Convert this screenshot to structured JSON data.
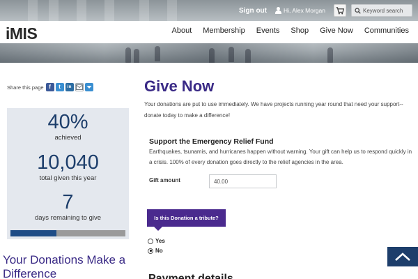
{
  "header": {
    "sign_out": "Sign out",
    "user_greeting": "Hi, Alex Morgan",
    "search_placeholder": "Keyword search",
    "logo": "iMIS",
    "nav": [
      "About",
      "Membership",
      "Events",
      "Shop",
      "Give Now",
      "Communities"
    ]
  },
  "share": {
    "label": "Share this page",
    "icons": [
      "facebook-icon",
      "twitter-icon",
      "linkedin-icon",
      "email-icon",
      "more-icon"
    ]
  },
  "stats": {
    "percent": "40%",
    "percent_label": "achieved",
    "total": "10,040",
    "total_label": "total given this year",
    "days": "7",
    "days_label": "days remaining to give",
    "progress_fraction": 0.4
  },
  "left_heading": "Your Donations Make a Difference",
  "main": {
    "title": "Give Now",
    "intro": "Your donations are put to use immediately. We have projects running year round that need your support--donate today to make a difference!",
    "fund_title": "Support the Emergency Relief Fund",
    "fund_desc": "Earthquakes, tsunamis, and hurricanes happen without warning. Your gift can help us to respond quickly in a crisis. 100% of every donation goes directly to the relief agencies in the area.",
    "gift_label": "Gift amount",
    "gift_value": "40.00",
    "tribute_question": "Is this Donation a tribute?",
    "options": [
      {
        "label": "Yes",
        "selected": false
      },
      {
        "label": "No",
        "selected": true
      }
    ],
    "next_heading": "Payment details"
  },
  "colors": {
    "heading": "#3a2a86",
    "stat_number": "#1d3e6b",
    "progress_fill": "#1e4c86",
    "tribute_bg": "#4a2a8e",
    "back_to_top": "#1d3e6b"
  }
}
